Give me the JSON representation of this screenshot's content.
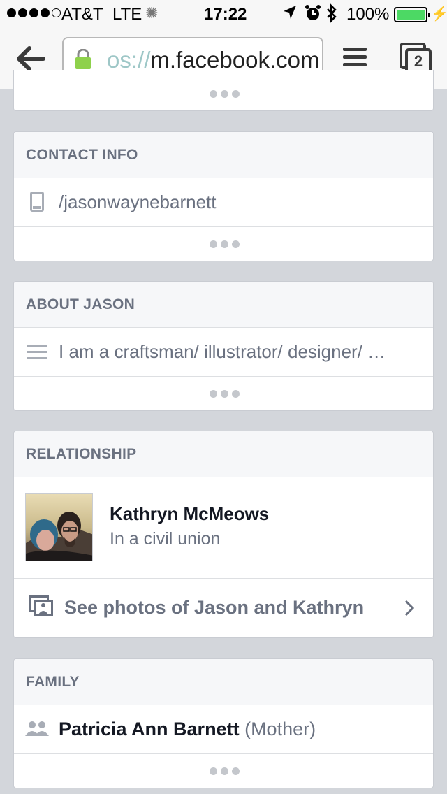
{
  "status_bar": {
    "carrier": "AT&T",
    "network": "LTE",
    "time": "17:22",
    "battery_percent": "100%"
  },
  "browser": {
    "url_faded": "os://",
    "url_main": "m.facebook.com",
    "tab_count": "2"
  },
  "contact_info": {
    "header": "CONTACT INFO",
    "mobile": "/jasonwaynebarnett"
  },
  "about": {
    "header": "ABOUT JASON",
    "bio": "I am a craftsman/ illustrator/ designer/ …"
  },
  "relationship": {
    "header": "RELATIONSHIP",
    "partner_name": "Kathryn McMeows",
    "status": "In a civil union",
    "photos_link": "See photos of Jason and Kathryn"
  },
  "family": {
    "header": "FAMILY",
    "member_name": "Patricia Ann Barnett",
    "member_relation": "(Mother)"
  },
  "icons": {
    "back": "back-arrow-icon",
    "lock": "lock-icon",
    "menu": "menu-icon",
    "tabs": "tabs-icon",
    "phone": "phone-icon",
    "about": "lines-icon",
    "photos": "photos-icon",
    "chevron": "chevron-right-icon",
    "family": "people-icon"
  },
  "colors": {
    "page_bg": "#d3d6db",
    "header_text": "#6a7180",
    "battery": "#4cd964"
  }
}
